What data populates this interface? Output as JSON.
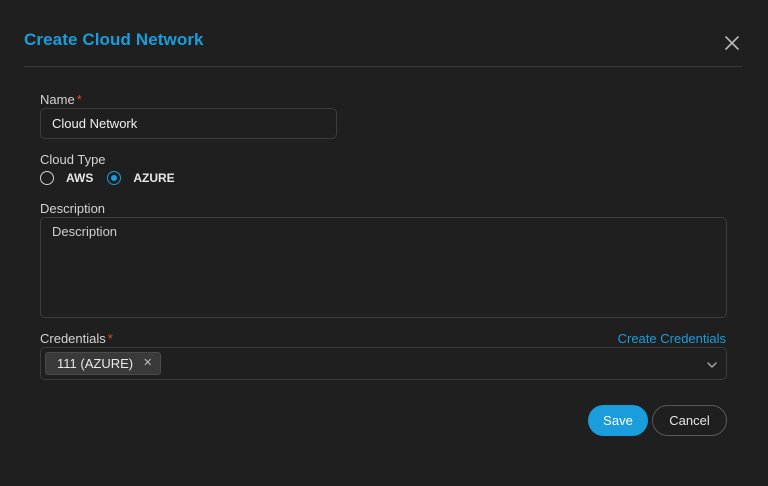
{
  "dialog": {
    "title": "Create Cloud Network",
    "close_icon": "close-icon"
  },
  "form": {
    "name": {
      "label": "Name",
      "required_mark": "*",
      "value": "Cloud Network"
    },
    "cloud_type": {
      "label": "Cloud Type",
      "options": [
        {
          "label": "AWS",
          "checked": false
        },
        {
          "label": "AZURE",
          "checked": true
        }
      ]
    },
    "description": {
      "label": "Description",
      "placeholder": "Description",
      "value": ""
    },
    "credentials": {
      "label": "Credentials",
      "required_mark": "*",
      "link": "Create Credentials",
      "selected_tags": [
        {
          "label": "111 (AZURE)",
          "remove_glyph": "✕"
        }
      ],
      "dropdown_icon": "chevron-down-icon"
    }
  },
  "actions": {
    "save": "Save",
    "cancel": "Cancel"
  },
  "colors": {
    "accent": "#1a9ddd",
    "required": "#e0452f",
    "background": "#1f1f1f"
  }
}
